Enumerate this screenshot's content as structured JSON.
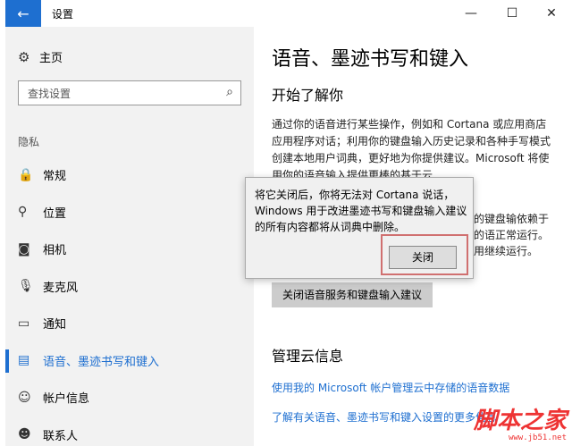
{
  "window": {
    "title": "设置",
    "back_icon": "←",
    "minimize": "—",
    "maximize": "☐",
    "close": "✕"
  },
  "sidebar": {
    "home": {
      "label": "主页",
      "icon": "⚙"
    },
    "search": {
      "placeholder": "查找设置",
      "icon": "⌕"
    },
    "section": "隐私",
    "items": [
      {
        "label": "常规",
        "icon": "🔒",
        "icon_name": "lock-icon"
      },
      {
        "label": "位置",
        "icon": "⚲",
        "icon_name": "location-icon"
      },
      {
        "label": "相机",
        "icon": "◙",
        "icon_name": "camera-icon"
      },
      {
        "label": "麦克风",
        "icon": "🎙",
        "icon_name": "microphone-icon"
      },
      {
        "label": "通知",
        "icon": "▭",
        "icon_name": "notification-icon"
      },
      {
        "label": "语音、墨迹书写和键入",
        "icon": "▤",
        "icon_name": "speech-icon",
        "active": true
      },
      {
        "label": "帐户信息",
        "icon": "☺",
        "icon_name": "account-info-icon"
      },
      {
        "label": "联系人",
        "icon": "☻",
        "icon_name": "contacts-icon"
      }
    ]
  },
  "main": {
    "title": "语音、墨迹书写和键入",
    "subtitle": "开始了解你",
    "description": "通过你的语音进行某些操作，例如和 Cortana 或应用商店应用程序对话；利用你的键盘输入历史记录和各种手写模式创建本地用户词典，更好地为你提供建议。Microsoft 将使用你的语音输入提供更棒的基于云",
    "description_tail": "你的键盘输依赖于云的语正常运行。使用继续运行。",
    "action_button": "关闭语音服务和键盘输入建议",
    "section2": "管理云信息",
    "link1": "使用我的 Microsoft 帐户管理云中存储的语音数据",
    "link2": "了解有关语音、墨迹书写和键入设置的更多信息"
  },
  "dialog": {
    "message": "将它关闭后，你将无法对 Cortana 说话，Windows 用于改进墨迹书写和键盘输入建议的所有内容都将从词典中删除。",
    "close_button": "关闭"
  },
  "watermark": {
    "text": "脚本之家",
    "url": "www.jb51.net"
  },
  "colors": {
    "accent": "#1e6fd0",
    "sidebar_bg": "#f2f2f2",
    "highlight_border": "#d07070"
  }
}
